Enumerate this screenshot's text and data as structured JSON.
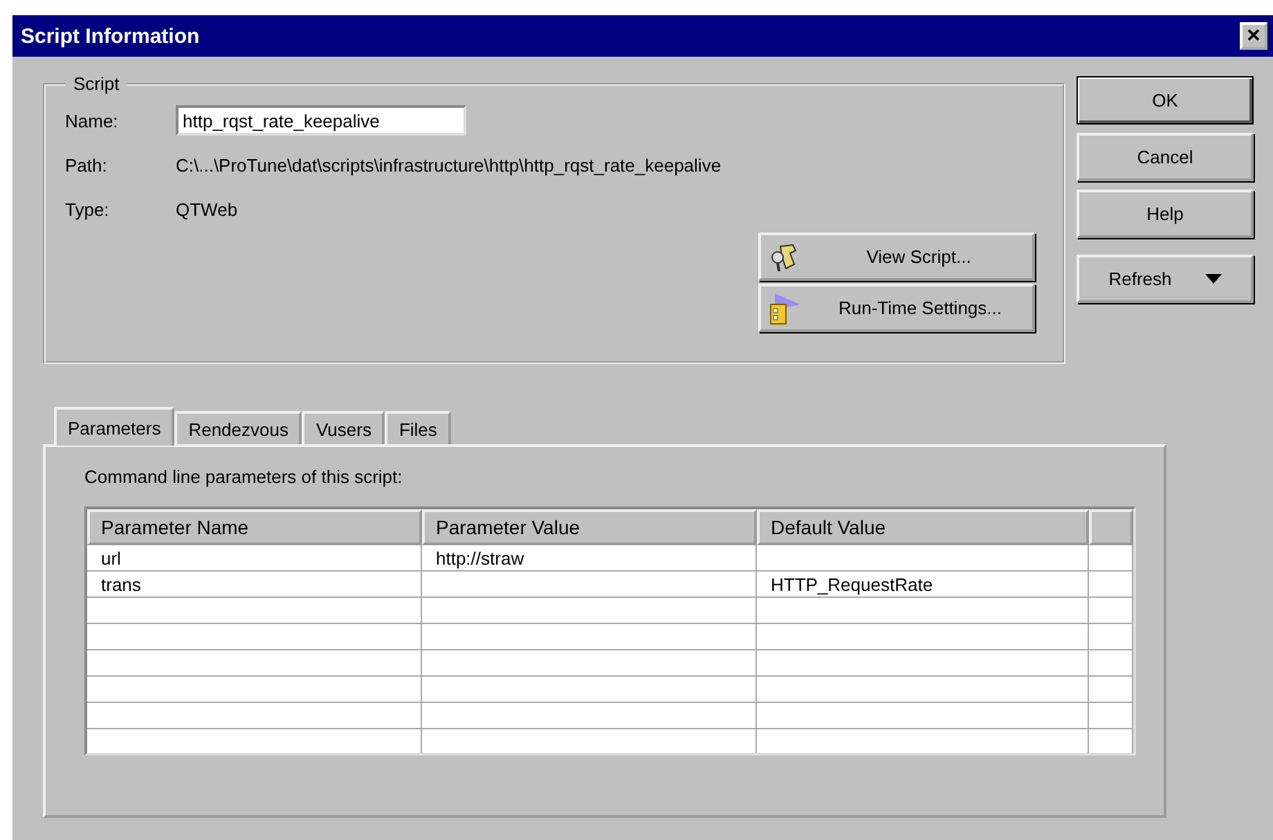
{
  "window": {
    "title": "Script Information",
    "close": "✕"
  },
  "script_group": {
    "title": "Script",
    "name_label": "Name:",
    "name_value": "http_rqst_rate_keepalive",
    "path_label": "Path:",
    "path_value": "C:\\...\\ProTune\\dat\\scripts\\infrastructure\\http\\http_rqst_rate_keepalive",
    "type_label": "Type:",
    "type_value": "QTWeb"
  },
  "script_buttons": [
    {
      "label": "View Script...",
      "kind": "view"
    },
    {
      "label": "Run-Time Settings...",
      "kind": "settings"
    }
  ],
  "side_buttons": [
    {
      "label": "OK",
      "default": true,
      "kind": "plain"
    },
    {
      "label": "Cancel",
      "default": false,
      "kind": "plain"
    },
    {
      "label": "Help",
      "default": false,
      "kind": "plain"
    },
    {
      "label": "Refresh",
      "default": false,
      "kind": "dropdown"
    }
  ],
  "tabs": [
    {
      "label": "Parameters",
      "selected": true
    },
    {
      "label": "Rendezvous",
      "selected": false
    },
    {
      "label": "Vusers",
      "selected": false
    },
    {
      "label": "Files",
      "selected": false
    }
  ],
  "panel": {
    "caption": "Command line parameters of this script:"
  },
  "table": {
    "columns": [
      "Parameter Name",
      "Parameter Value",
      "Default Value"
    ],
    "rows": [
      [
        "url",
        "http://straw",
        ""
      ],
      [
        "trans",
        "",
        "HTTP_RequestRate"
      ]
    ]
  }
}
